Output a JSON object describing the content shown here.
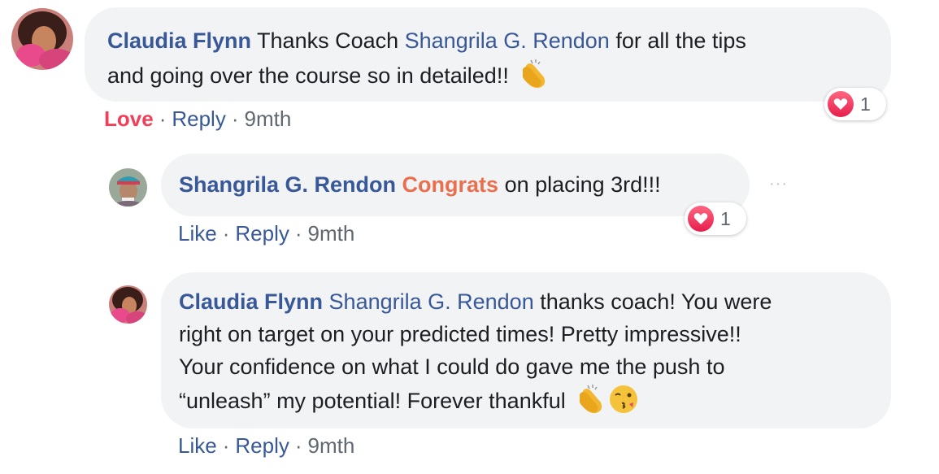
{
  "comments": [
    {
      "author": "Claudia Flynn",
      "text_before": "Thanks Coach ",
      "mention": "Shangrila G. Rendon",
      "text_line1_after": " for all the tips",
      "text_line2": "and going over the course so in detailed!!",
      "emojis": [
        "clapping-hands"
      ],
      "reaction_count": "1",
      "actions": {
        "love": "Love",
        "reply": "Reply",
        "time": "9mth"
      }
    },
    {
      "author": "Shangrila G. Rendon",
      "highlight": "Congrats",
      "text": " on placing 3rd!!!",
      "reaction_count": "1",
      "more_icon": "···",
      "actions": {
        "like": "Like",
        "reply": "Reply",
        "time": "9mth"
      }
    },
    {
      "author": "Claudia Flynn",
      "mention": "Shangrila G. Rendon",
      "text_line1_after": " thanks coach! You were",
      "text_line2": "right on target on your predicted times! Pretty impressive!!",
      "text_line3": "Your confidence on what I could do gave me the push to",
      "text_line4": "“unleash” my potential! Forever thankful",
      "emojis": [
        "clapping-hands",
        "kissing-face-winking"
      ],
      "actions": {
        "like": "Like",
        "reply": "Reply",
        "time": "9mth"
      }
    }
  ],
  "separator": "·",
  "colors": {
    "link": "#385898",
    "love": "#f33e58",
    "highlight": "#e9704f",
    "bubble": "#f2f3f5"
  }
}
